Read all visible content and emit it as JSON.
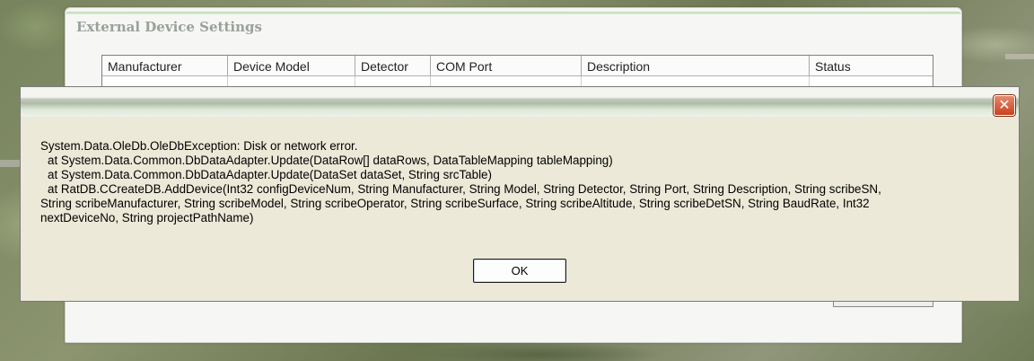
{
  "background_window": {
    "title": "External Device Settings",
    "columns": [
      "Manufacturer",
      "Device Model",
      "Detector",
      "COM Port",
      "Description",
      "Status"
    ]
  },
  "error_dialog": {
    "close_glyph": "✕",
    "message_lines": [
      "System.Data.OleDb.OleDbException: Disk or network error.",
      "at System.Data.Common.DbDataAdapter.Update(DataRow[] dataRows, DataTableMapping tableMapping)",
      "at System.Data.Common.DbDataAdapter.Update(DataSet dataSet, String srcTable)",
      "at RatDB.CCreateDB.AddDevice(Int32 configDeviceNum, String Manufacturer, String Model, String Detector, String Port, String Description, String scribeSN,",
      "String scribeManufacturer, String scribeModel, String scribeOperator, String scribeSurface, String scribeAltitude, String scribeDetSN, String BaudRate, Int32",
      "nextDeviceNo, String projectPathName)"
    ],
    "ok_label": "OK"
  },
  "colors": {
    "dialog_face": "#ece9d8",
    "close_button": "#c8421f",
    "title_gradient": "#aebba6"
  }
}
